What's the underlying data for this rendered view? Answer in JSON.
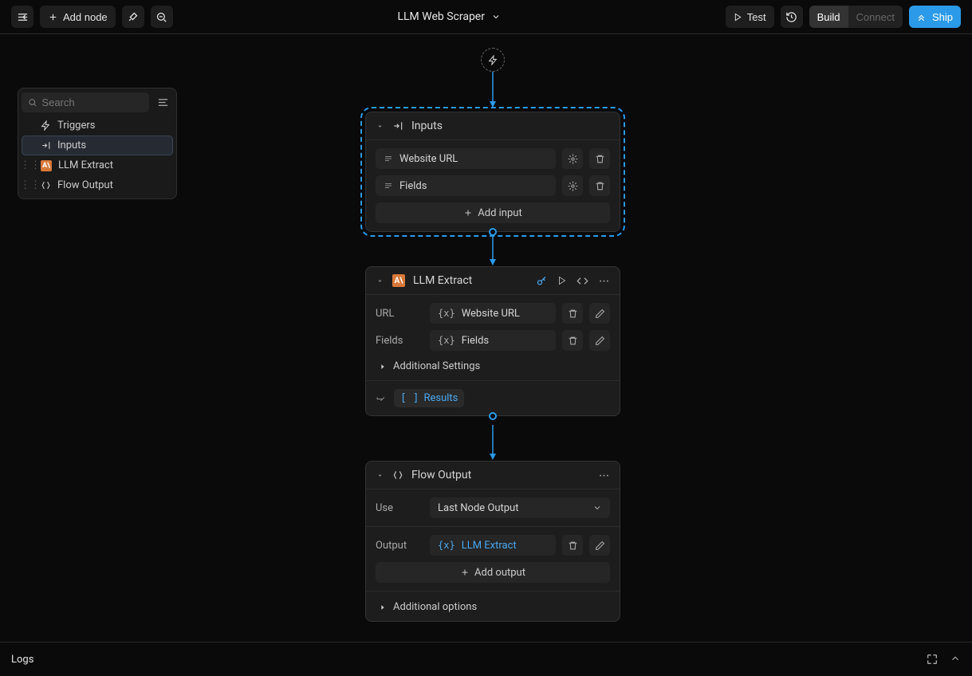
{
  "header": {
    "add_node": "Add node",
    "title": "LLM Web Scraper",
    "test": "Test",
    "build": "Build",
    "connect": "Connect",
    "ship": "Ship"
  },
  "sidebar": {
    "search_placeholder": "Search",
    "items": [
      {
        "label": "Triggers"
      },
      {
        "label": "Inputs"
      },
      {
        "label": "LLM Extract"
      },
      {
        "label": "Flow Output"
      }
    ]
  },
  "node_inputs": {
    "title": "Inputs",
    "fields": [
      {
        "label": "Website URL"
      },
      {
        "label": "Fields"
      }
    ],
    "add": "Add input"
  },
  "node_llm": {
    "title": "LLM Extract",
    "params": [
      {
        "label": "URL",
        "value": "Website URL"
      },
      {
        "label": "Fields",
        "value": "Fields"
      }
    ],
    "additional": "Additional Settings",
    "results": "Results"
  },
  "node_output": {
    "title": "Flow Output",
    "use_label": "Use",
    "use_value": "Last Node Output",
    "output_label": "Output",
    "output_value": "LLM Extract",
    "add": "Add output",
    "additional": "Additional options"
  },
  "logs": {
    "label": "Logs"
  }
}
